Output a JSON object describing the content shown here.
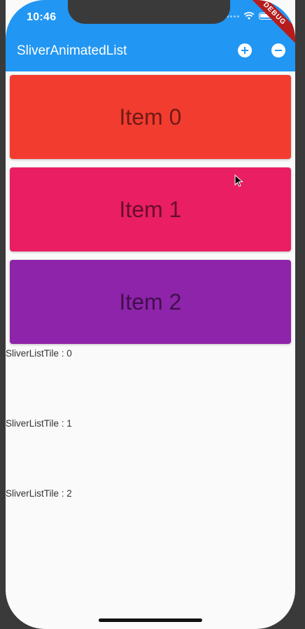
{
  "status_bar": {
    "time": "10:46"
  },
  "debug_banner": "DEBUG",
  "app_bar": {
    "title": "SliverAnimatedList",
    "color": "#2196f3",
    "actions": [
      {
        "icon": "add-circle-icon"
      },
      {
        "icon": "remove-circle-icon"
      }
    ]
  },
  "cards": [
    {
      "label": "Item 0",
      "color": "#f33c30"
    },
    {
      "label": "Item 1",
      "color": "#e91e63"
    },
    {
      "label": "Item 2",
      "color": "#8e24aa"
    }
  ],
  "tiles": [
    {
      "label": "SliverListTile : 0"
    },
    {
      "label": "SliverListTile : 1"
    },
    {
      "label": "SliverListTile : 2"
    }
  ]
}
